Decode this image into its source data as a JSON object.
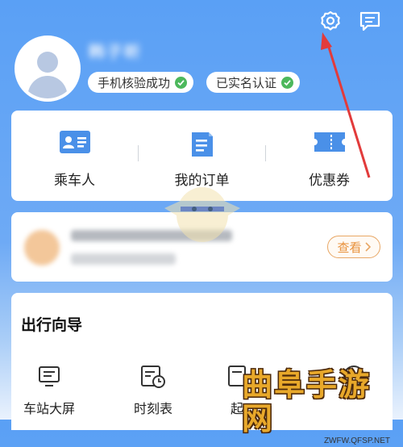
{
  "header": {
    "username": "韩子昕",
    "badges": {
      "phone": "手机核验成功",
      "realname": "已实名认证"
    },
    "icons": {
      "settings": "gear-icon",
      "messages": "message-icon"
    }
  },
  "quick_actions": [
    {
      "label": "乘车人",
      "icon": "passenger-card-icon"
    },
    {
      "label": "我的订单",
      "icon": "order-document-icon"
    },
    {
      "label": "优惠券",
      "icon": "coupon-icon"
    }
  ],
  "promo": {
    "action_label": "查看"
  },
  "travel_guide": {
    "title": "出行向导",
    "items": [
      {
        "label": "车站大屏",
        "icon": "station-screen-icon"
      },
      {
        "label": "时刻表",
        "icon": "timetable-icon"
      },
      {
        "label": "起",
        "icon": "origin-icon"
      },
      {
        "label": "",
        "icon": "info-icon"
      }
    ]
  },
  "watermark": {
    "title": "曲阜手游网",
    "url": "ZWFW.QFSP.NET"
  },
  "colors": {
    "brand_blue": "#5aa0f5",
    "icon_blue": "#4a90e8",
    "check_green": "#4cb85c",
    "promo_orange": "#e8913b",
    "annotation_red": "#e23b3b"
  }
}
